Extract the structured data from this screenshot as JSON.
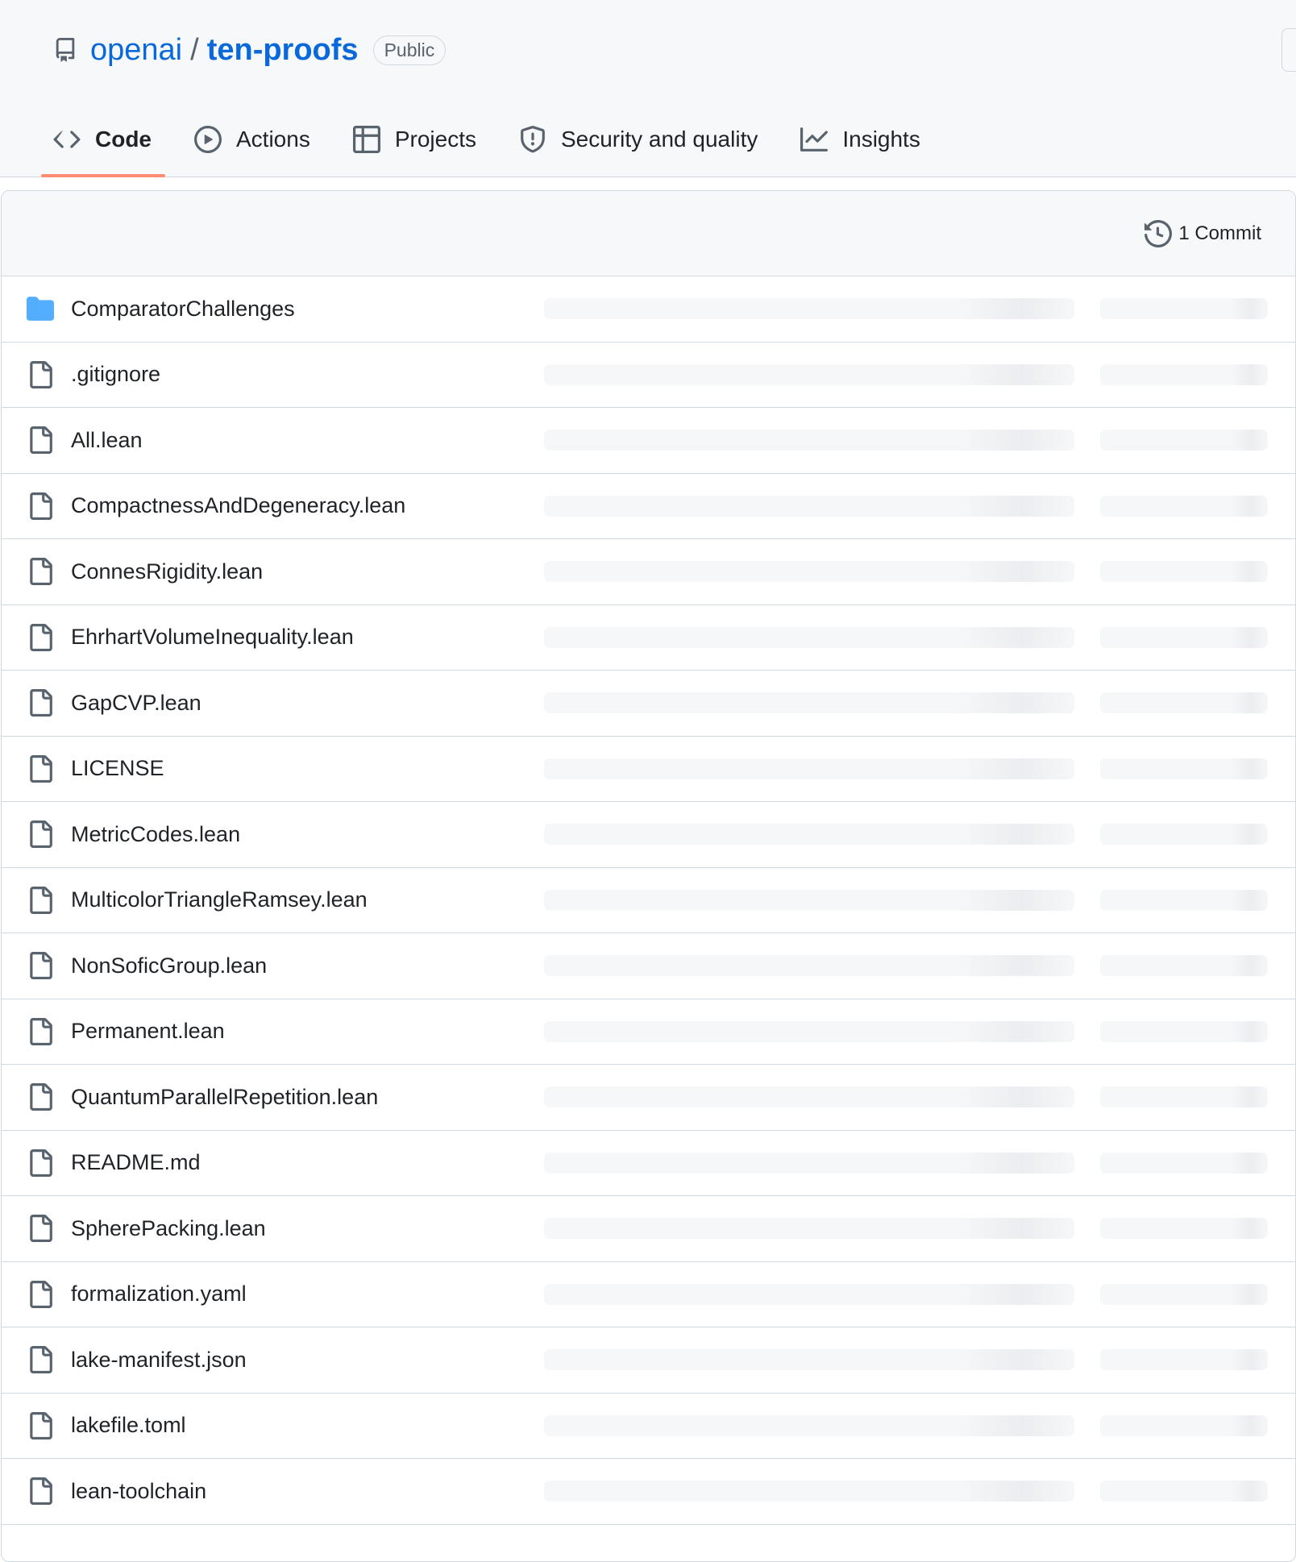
{
  "header": {
    "owner": "openai",
    "separator": "/",
    "repo": "ten-proofs",
    "visibility": "Public"
  },
  "tabs": [
    {
      "label": "Code",
      "icon": "code-icon",
      "active": true
    },
    {
      "label": "Actions",
      "icon": "play-circle-icon"
    },
    {
      "label": "Projects",
      "icon": "table-icon"
    },
    {
      "label": "Security and quality",
      "icon": "shield-icon"
    },
    {
      "label": "Insights",
      "icon": "graph-icon"
    }
  ],
  "commits": {
    "label": "1 Commit",
    "icon": "history-icon"
  },
  "files": [
    {
      "name": "ComparatorChallenges",
      "type": "folder"
    },
    {
      "name": ".gitignore",
      "type": "file"
    },
    {
      "name": "All.lean",
      "type": "file"
    },
    {
      "name": "CompactnessAndDegeneracy.lean",
      "type": "file"
    },
    {
      "name": "ConnesRigidity.lean",
      "type": "file"
    },
    {
      "name": "EhrhartVolumeInequality.lean",
      "type": "file"
    },
    {
      "name": "GapCVP.lean",
      "type": "file"
    },
    {
      "name": "LICENSE",
      "type": "file"
    },
    {
      "name": "MetricCodes.lean",
      "type": "file"
    },
    {
      "name": "MulticolorTriangleRamsey.lean",
      "type": "file"
    },
    {
      "name": "NonSoficGroup.lean",
      "type": "file"
    },
    {
      "name": "Permanent.lean",
      "type": "file"
    },
    {
      "name": "QuantumParallelRepetition.lean",
      "type": "file"
    },
    {
      "name": "README.md",
      "type": "file"
    },
    {
      "name": "SpherePacking.lean",
      "type": "file"
    },
    {
      "name": "formalization.yaml",
      "type": "file"
    },
    {
      "name": "lake-manifest.json",
      "type": "file"
    },
    {
      "name": "lakefile.toml",
      "type": "file"
    },
    {
      "name": "lean-toolchain",
      "type": "file"
    }
  ],
  "colors": {
    "link": "#0969da",
    "folder": "#54aeff",
    "tab_underline": "#fd8c73",
    "border": "#d1d9e0",
    "header_bg": "#f6f8fa"
  }
}
